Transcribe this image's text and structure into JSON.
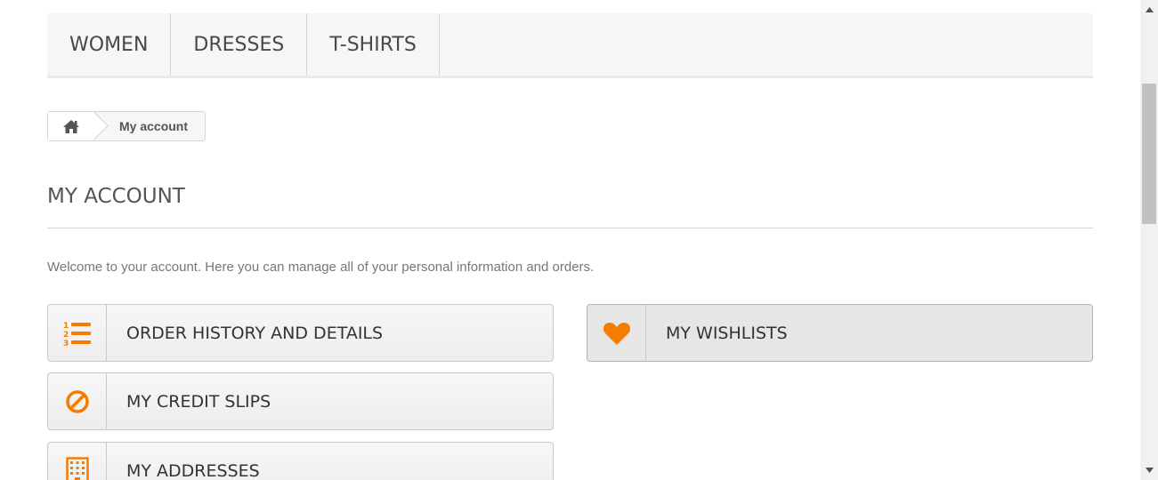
{
  "menu": {
    "items": [
      {
        "label": "WOMEN"
      },
      {
        "label": "DRESSES"
      },
      {
        "label": "T-SHIRTS"
      }
    ]
  },
  "breadcrumb": {
    "home_icon": "home-icon",
    "current": "My account"
  },
  "page": {
    "title": "MY ACCOUNT",
    "info": "Welcome to your account. Here you can manage all of your personal information and orders."
  },
  "account_links": [
    {
      "label": "ORDER HISTORY AND DETAILS",
      "icon": "numbered-list-icon"
    },
    {
      "label": "MY CREDIT SLIPS",
      "icon": "ban-icon"
    },
    {
      "label": "MY ADDRESSES",
      "icon": "building-icon"
    },
    {
      "label": "MY WISHLISTS",
      "icon": "heart-icon"
    }
  ],
  "colors": {
    "accent": "#f57c00",
    "menu_bg": "#f6f6f6",
    "border": "#d6d4d4"
  }
}
